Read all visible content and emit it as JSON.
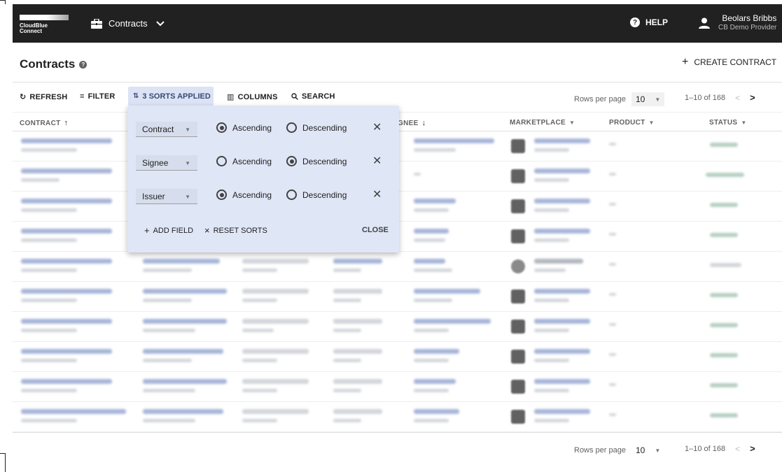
{
  "app": {
    "logo_line1": "CloudBlue",
    "logo_line2": "Connect",
    "module_name": "Contracts",
    "help_label": "HELP",
    "user_name": "Beolars Bribbs",
    "user_org": "CB Demo Provider"
  },
  "page": {
    "title": "Contracts",
    "create_label": "CREATE CONTRACT"
  },
  "toolbar": {
    "refresh_label": "REFRESH",
    "filter_label": "FILTER",
    "sorts_label": "3 SORTS APPLIED",
    "columns_label": "COLUMNS",
    "search_label": "SEARCH",
    "rows_per_page_label": "Rows per page",
    "rows_per_page_value": "10",
    "range_label": "1–10 of 168"
  },
  "table": {
    "columns": {
      "contract": "CONTRACT",
      "signee": "SIGNEE",
      "marketplace": "MARKETPLACE",
      "product": "PRODUCT",
      "status": "STATUS"
    }
  },
  "footer": {
    "rows_per_page_label": "Rows per page",
    "rows_per_page_value": "10",
    "range_label": "1–10 of 168"
  },
  "sort_popup": {
    "sorts": [
      {
        "field": "Contract",
        "ascending_label": "Ascending",
        "descending_label": "Descending",
        "direction": "ascending"
      },
      {
        "field": "Signee",
        "ascending_label": "Ascending",
        "descending_label": "Descending",
        "direction": "descending"
      },
      {
        "field": "Issuer",
        "ascending_label": "Ascending",
        "descending_label": "Descending",
        "direction": "ascending"
      }
    ],
    "add_field_label": "ADD FIELD",
    "reset_label": "RESET SORTS",
    "close_label": "CLOSE"
  },
  "colors": {
    "topbar": "#212121",
    "accent_sorts": "#dbe3f5",
    "popup_bg": "#dfe6f6"
  }
}
